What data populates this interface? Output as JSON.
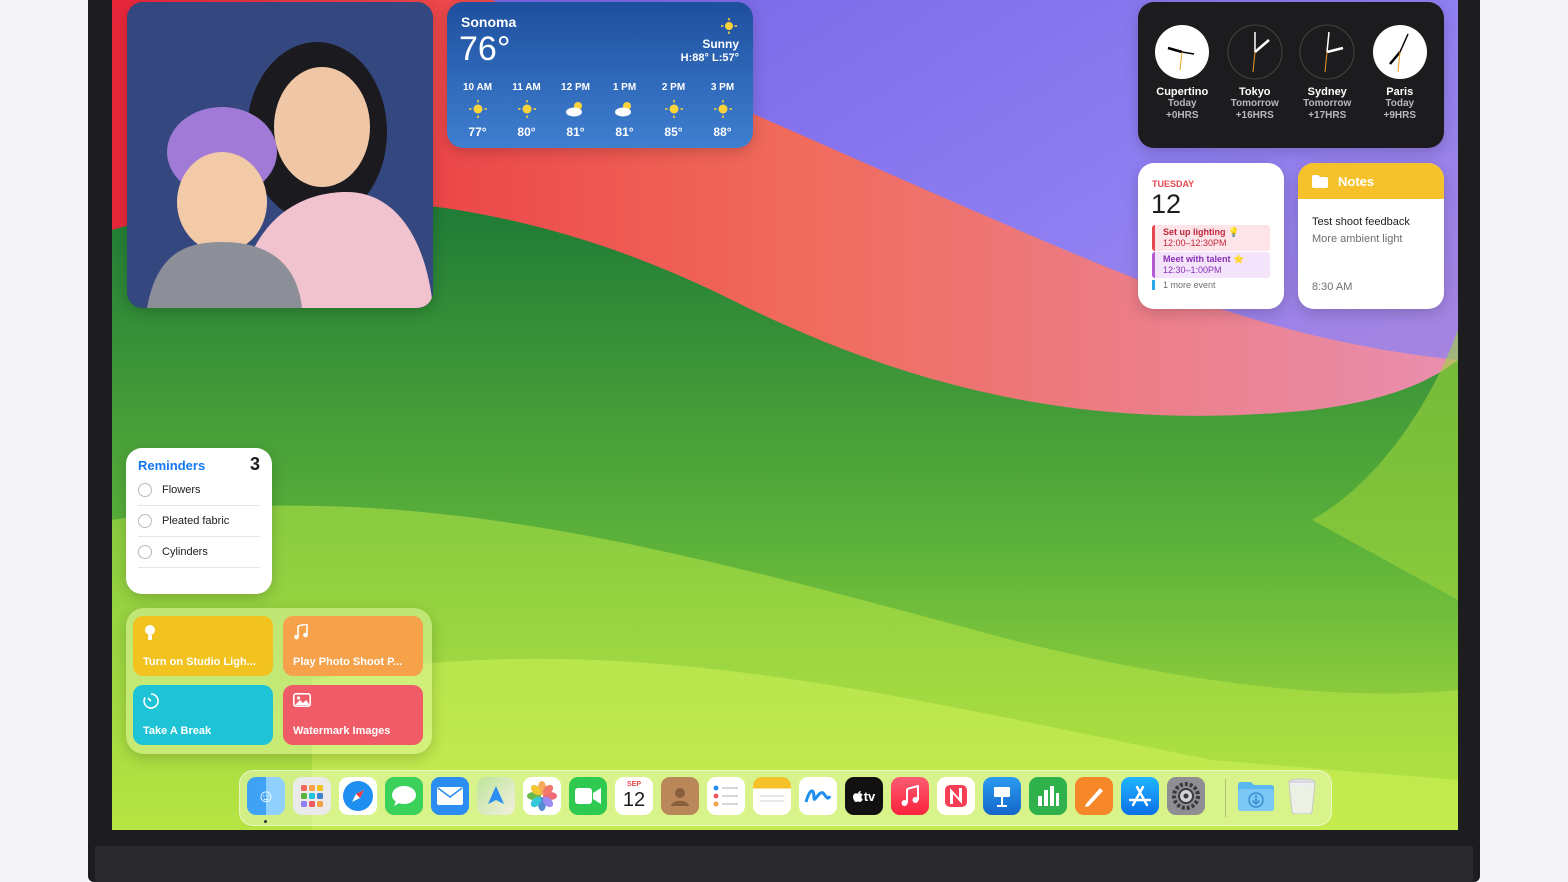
{
  "weather": {
    "location": "Sonoma",
    "temp": "76°",
    "condition": "Sunny",
    "high_low": "H:88° L:57°",
    "hourly": [
      {
        "time": "10 AM",
        "temp": "77°",
        "icon": "sun-icon"
      },
      {
        "time": "11 AM",
        "temp": "80°",
        "icon": "sun-icon"
      },
      {
        "time": "12 PM",
        "temp": "81°",
        "icon": "partly-cloudy-icon"
      },
      {
        "time": "1 PM",
        "temp": "81°",
        "icon": "partly-cloudy-icon"
      },
      {
        "time": "2 PM",
        "temp": "85°",
        "icon": "sun-icon"
      },
      {
        "time": "3 PM",
        "temp": "88°",
        "icon": "sun-icon"
      }
    ]
  },
  "world_clock": [
    {
      "city": "Cupertino",
      "day": "Today",
      "offset": "+0HRS"
    },
    {
      "city": "Tokyo",
      "day": "Tomorrow",
      "offset": "+16HRS"
    },
    {
      "city": "Sydney",
      "day": "Tomorrow",
      "offset": "+17HRS"
    },
    {
      "city": "Paris",
      "day": "Today",
      "offset": "+9HRS"
    }
  ],
  "calendar": {
    "weekday": "TUESDAY",
    "day": "12",
    "events": [
      {
        "title": "Set up lighting 💡",
        "time": "12:00–12:30PM"
      },
      {
        "title": "Meet with talent ⭐",
        "time": "12:30–1:00PM"
      }
    ],
    "more": "1 more event"
  },
  "notes": {
    "header": "Notes",
    "title": "Test shoot feedback",
    "body": "More ambient light",
    "time": "8:30 AM"
  },
  "reminders": {
    "title": "Reminders",
    "count": "3",
    "items": [
      "Flowers",
      "Pleated fabric",
      "Cylinders"
    ]
  },
  "shortcuts": [
    {
      "label": "Turn on Studio Ligh...",
      "icon": "lightbulb-icon",
      "color": "#f2c21e"
    },
    {
      "label": "Play Photo Shoot P...",
      "icon": "music-note-icon",
      "color": "#f5a24a"
    },
    {
      "label": "Take A Break",
      "icon": "timer-icon",
      "color": "#1ec3d6"
    },
    {
      "label": "Watermark Images",
      "icon": "photo-icon",
      "color": "#ef5b66"
    }
  ],
  "dock": {
    "calendar_month": "SEP",
    "calendar_day": "12",
    "apps": [
      "finder-icon",
      "launchpad-icon",
      "safari-icon",
      "messages-icon",
      "mail-icon",
      "maps-icon",
      "photos-icon",
      "facetime-icon",
      "calendar-icon",
      "contacts-icon",
      "reminders-icon",
      "notes-icon",
      "freeform-icon",
      "apple-tv-icon",
      "music-icon",
      "news-icon",
      "keynote-icon",
      "numbers-icon",
      "pages-icon",
      "app-store-icon",
      "system-settings-icon",
      "downloads-folder-icon",
      "trash-icon"
    ],
    "tv_label": "tv"
  }
}
